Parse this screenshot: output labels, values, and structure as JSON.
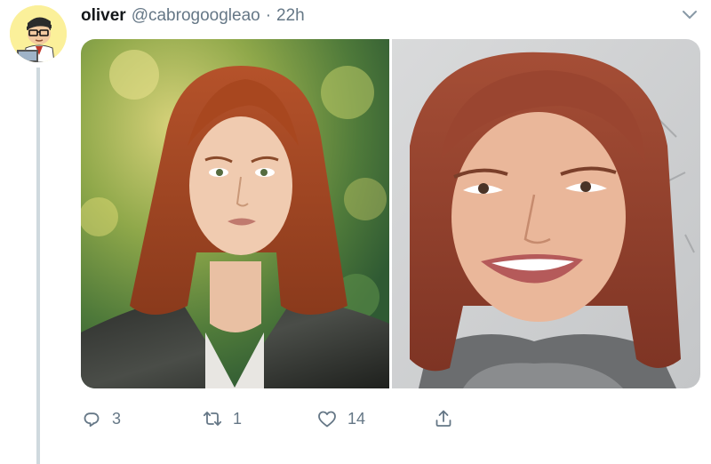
{
  "tweet": {
    "display_name": "oliver",
    "handle": "@cabrogoogleao",
    "separator": "·",
    "time": "22h"
  },
  "actions": {
    "reply_count": "3",
    "retweet_count": "1",
    "like_count": "14"
  },
  "colors": {
    "text_primary": "#14171a",
    "text_secondary": "#657786",
    "thread_line": "#cfd9de",
    "avatar_background": "#fbf09a"
  },
  "icons": {
    "menu": "chevron-down-icon",
    "reply": "reply-icon",
    "retweet": "retweet-icon",
    "like": "heart-icon",
    "share": "share-icon"
  }
}
